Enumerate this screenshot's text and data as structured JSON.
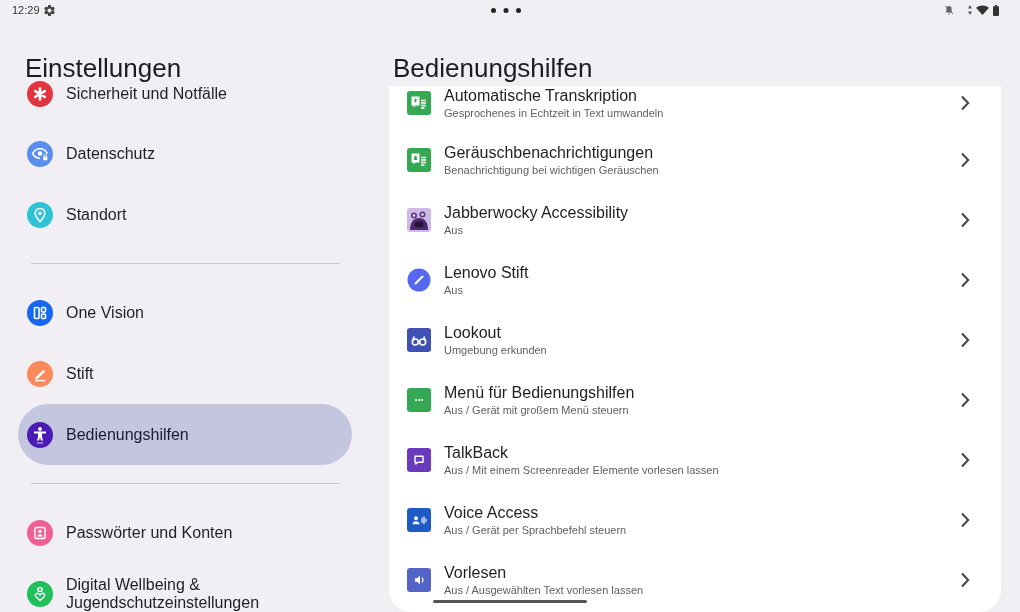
{
  "status_bar": {
    "time": "12:29"
  },
  "sidebar": {
    "title": "Einstellungen",
    "groups": [
      {
        "items": [
          {
            "label": "Sicherheit und Notfälle",
            "selected": false
          },
          {
            "label": "Datenschutz",
            "selected": false
          },
          {
            "label": "Standort",
            "selected": false
          }
        ]
      },
      {
        "items": [
          {
            "label": "One Vision",
            "selected": false
          },
          {
            "label": "Stift",
            "selected": false
          },
          {
            "label": "Bedienungshilfen",
            "selected": true
          }
        ]
      },
      {
        "items": [
          {
            "label": "Passwörter und Konten",
            "selected": false
          },
          {
            "label": "Digital Wellbeing & Jugendschutzeinstellungen",
            "selected": false
          }
        ]
      }
    ]
  },
  "content": {
    "title": "Bedienungshilfen",
    "items": [
      {
        "title": "Automatische Transkription",
        "summary": "Gesprochenes in Echtzeit in Text umwandeln"
      },
      {
        "title": "Geräuschbenachrichtigungen",
        "summary": "Benachrichtigung bei wichtigen Geräuschen"
      },
      {
        "title": "Jabberwocky Accessibility",
        "summary": "Aus"
      },
      {
        "title": "Lenovo Stift",
        "summary": "Aus"
      },
      {
        "title": "Lookout",
        "summary": "Umgebung erkunden"
      },
      {
        "title": "Menü für Bedienungshilfen",
        "summary": "Aus / Gerät mit großem Menü steuern"
      },
      {
        "title": "TalkBack",
        "summary": "Aus / Mit einem Screenreader Elemente vorlesen lassen"
      },
      {
        "title": "Voice Access",
        "summary": "Aus / Gerät per Sprachbefehl steuern"
      },
      {
        "title": "Vorlesen",
        "summary": "Aus / Ausgewählten Text vorlesen lassen"
      }
    ]
  }
}
